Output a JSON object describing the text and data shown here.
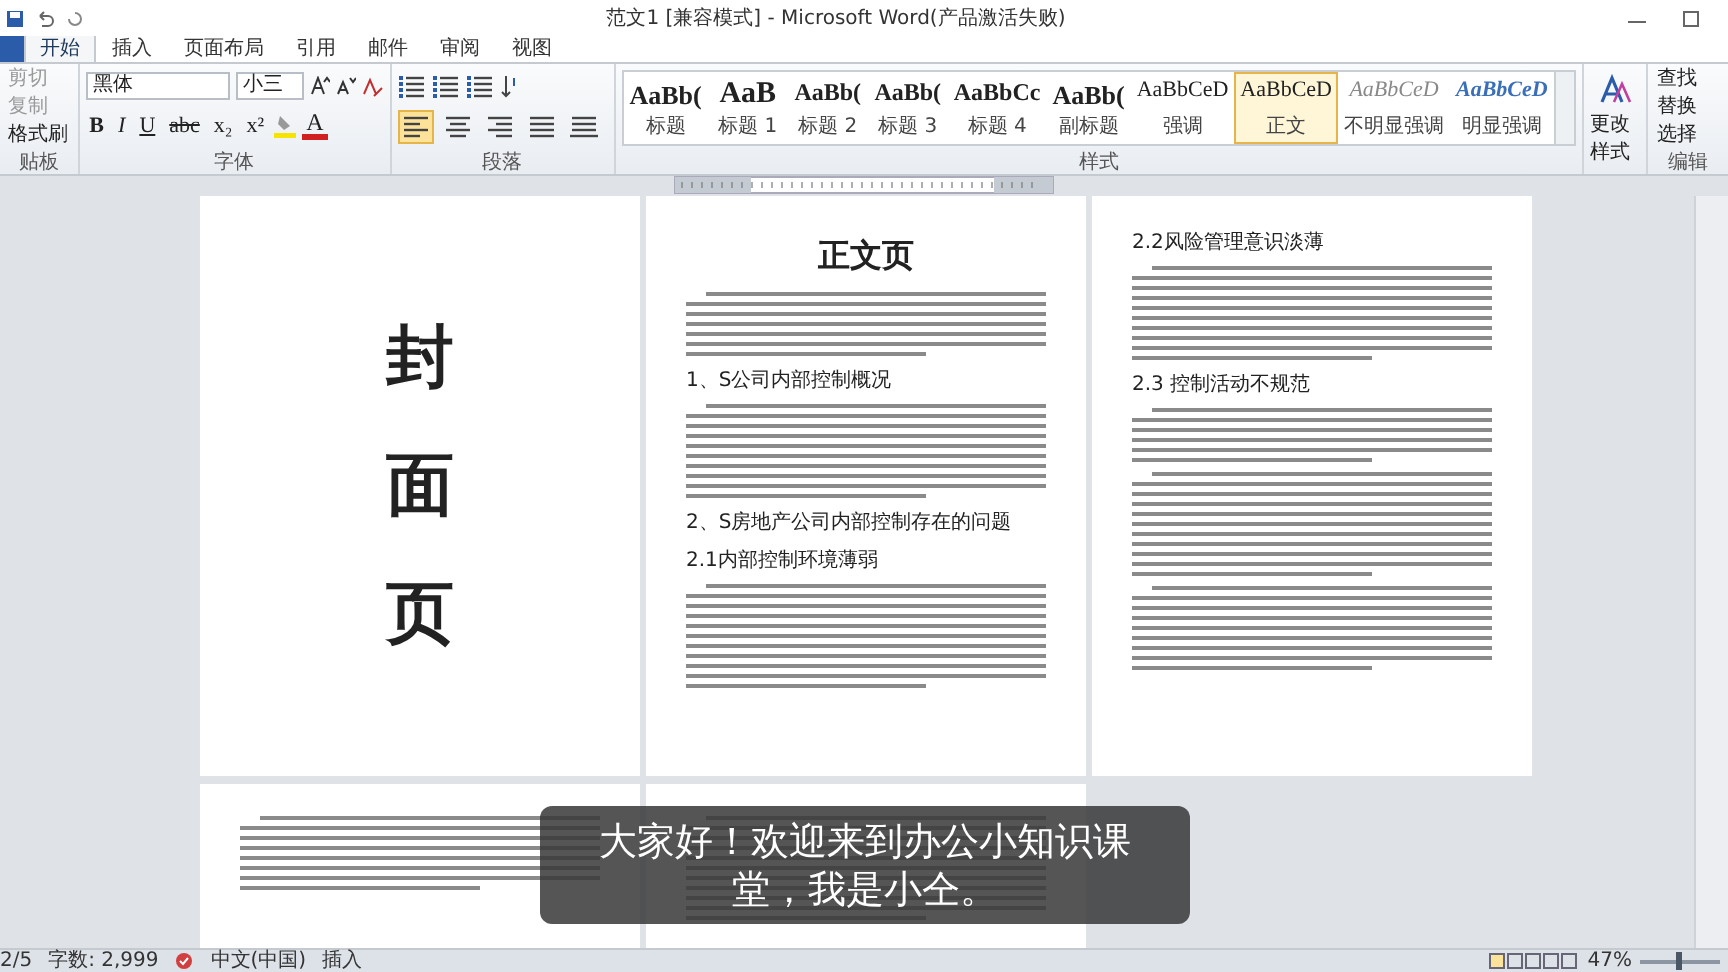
{
  "window": {
    "title": "范文1 [兼容模式] - Microsoft Word(产品激活失败)"
  },
  "tabs": [
    {
      "label": "开始",
      "selected": true
    },
    {
      "label": "插入",
      "selected": false
    },
    {
      "label": "页面布局",
      "selected": false
    },
    {
      "label": "引用",
      "selected": false
    },
    {
      "label": "邮件",
      "selected": false
    },
    {
      "label": "审阅",
      "selected": false
    },
    {
      "label": "视图",
      "selected": false
    }
  ],
  "clipboard": {
    "label": "贴板",
    "items": [
      {
        "label": "剪切",
        "disabled": true
      },
      {
        "label": "复制",
        "disabled": true
      },
      {
        "label": "格式刷",
        "disabled": false
      }
    ]
  },
  "font": {
    "label": "字体",
    "family": "黑体",
    "size": "小三",
    "format_buttons": [
      {
        "label": "B",
        "kind": "bold"
      },
      {
        "label": "I",
        "kind": "italic"
      },
      {
        "label": "U",
        "kind": "underline"
      },
      {
        "label": "abc",
        "kind": "strike"
      },
      {
        "label": "x₂",
        "kind": "plain"
      },
      {
        "label": "x²",
        "kind": "plain"
      }
    ],
    "color_button": {
      "label": "A",
      "color": "#d02020"
    }
  },
  "paragraph": {
    "label": "段落",
    "alignments": [
      {
        "kind": "left",
        "selected": true
      },
      {
        "kind": "center",
        "selected": false
      },
      {
        "kind": "right",
        "selected": false
      },
      {
        "kind": "justify",
        "selected": false
      },
      {
        "kind": "distributed",
        "selected": false
      }
    ]
  },
  "styles": {
    "label": "样式",
    "items": [
      {
        "preview": "AaBb(",
        "name": "标题",
        "kind": "title",
        "selected": false
      },
      {
        "preview": "AaB",
        "name": "标题 1",
        "kind": "heading1",
        "selected": false
      },
      {
        "preview": "AaBb(",
        "name": "标题 2",
        "kind": "heading",
        "selected": false
      },
      {
        "preview": "AaBb(",
        "name": "标题 3",
        "kind": "heading",
        "selected": false
      },
      {
        "preview": "AaBbCc",
        "name": "标题 4",
        "kind": "heading",
        "selected": false
      },
      {
        "preview": "AaBb(",
        "name": "副标题",
        "kind": "title",
        "selected": false
      },
      {
        "preview": "AaBbCeD",
        "name": "强调",
        "kind": "normal",
        "selected": false
      },
      {
        "preview": "AaBbCeD",
        "name": "正文",
        "kind": "normal",
        "selected": true
      },
      {
        "preview": "AaBbCeD",
        "name": "不明显强调",
        "kind": "subtle",
        "selected": false
      },
      {
        "preview": "AaBbCeD",
        "name": "明显强调",
        "kind": "intense",
        "selected": false
      }
    ]
  },
  "change_styles": {
    "label": "更改样式"
  },
  "editing": {
    "label": "编辑",
    "items": [
      "查找",
      "替换",
      "选择"
    ]
  },
  "pages": [
    {
      "kind": "cover",
      "blocks": [
        {
          "kind": "cover-char",
          "text": "封"
        },
        {
          "kind": "cover-char",
          "text": "面"
        },
        {
          "kind": "cover-char",
          "text": "页"
        }
      ]
    },
    {
      "kind": "body",
      "blocks": [
        {
          "kind": "title",
          "text": "正文页"
        },
        {
          "kind": "paragraph"
        },
        {
          "kind": "heading",
          "text": "1、S公司内部控制概况"
        },
        {
          "kind": "paragraph"
        },
        {
          "kind": "heading",
          "text": "2、S房地产公司内部控制存在的问题"
        },
        {
          "kind": "heading",
          "text": "2.1内部控制环境薄弱"
        },
        {
          "kind": "paragraph"
        }
      ]
    },
    {
      "kind": "body",
      "blocks": [
        {
          "kind": "heading",
          "text": "2.2风险管理意识淡薄"
        },
        {
          "kind": "paragraph"
        },
        {
          "kind": "heading",
          "text": "2.3 控制活动不规范"
        },
        {
          "kind": "paragraph"
        },
        {
          "kind": "paragraph"
        },
        {
          "kind": "paragraph"
        }
      ]
    },
    {
      "kind": "body",
      "blocks": [
        {
          "kind": "paragraph"
        }
      ]
    },
    {
      "kind": "body",
      "blocks": [
        {
          "kind": "paragraph"
        }
      ]
    }
  ],
  "subtitle": [
    "大家好！欢迎来到办公小知识课",
    "堂，我是小仝。"
  ],
  "status_bar": {
    "page": "2/5",
    "words": "字数: 2,999",
    "language": "中文(中国)",
    "mode": "插入",
    "zoom": "47%",
    "zoom_level": {
      "level": 0.47
    }
  }
}
